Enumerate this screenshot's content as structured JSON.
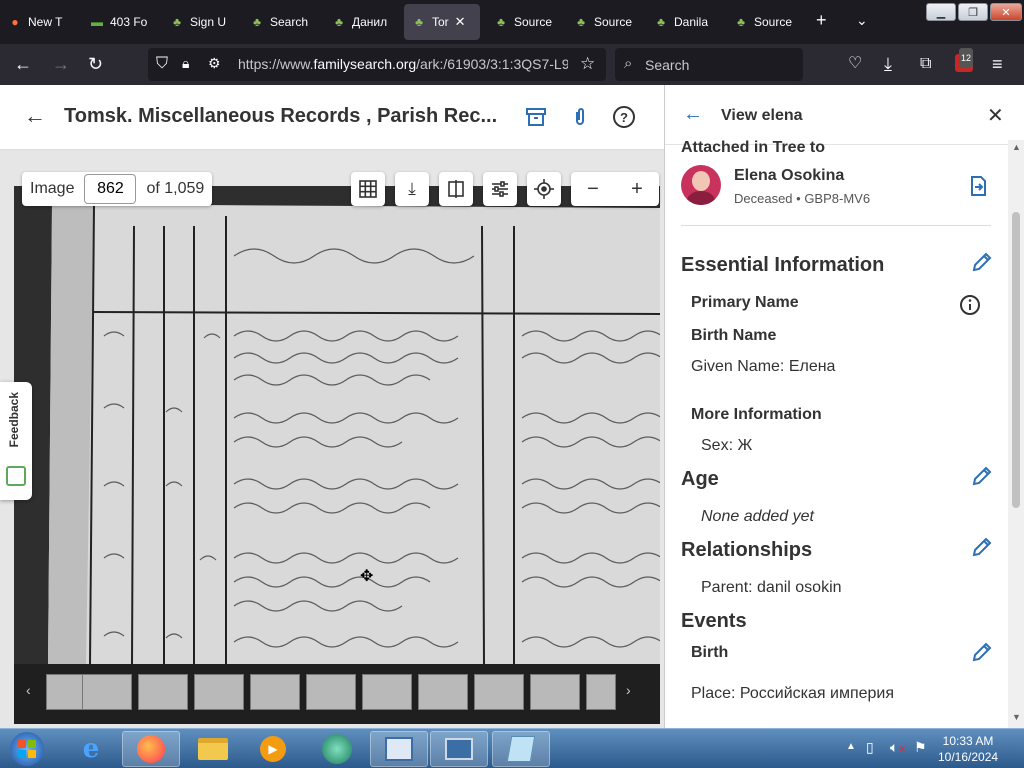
{
  "browser": {
    "tabs": [
      {
        "label": "New T",
        "icon": "firefox-icon"
      },
      {
        "label": "403 Fo",
        "icon": "flag-icon"
      },
      {
        "label": "Sign U",
        "icon": "tree-icon"
      },
      {
        "label": "Search",
        "icon": "tree-icon"
      },
      {
        "label": "Данил",
        "icon": "tree-icon"
      },
      {
        "label": "Tor",
        "icon": "tree-icon",
        "active": true
      },
      {
        "label": "Source",
        "icon": "tree-icon"
      },
      {
        "label": "Source",
        "icon": "tree-icon"
      },
      {
        "label": "Danila",
        "icon": "tree-icon"
      },
      {
        "label": "Source",
        "icon": "tree-icon"
      }
    ],
    "url_prefix": "https://www.",
    "url_domain": "familysearch.org",
    "url_path": "/ark:/61903/3:1:3QS7-L9",
    "search_placeholder": "Search",
    "extension_badge": "12"
  },
  "viewer": {
    "title": "Tomsk. Miscellaneous Records , Parish Rec...",
    "image_label": "Image",
    "image_number": "862",
    "image_total": "of 1,059",
    "feedback_label": "Feedback"
  },
  "panel": {
    "title": "View elena",
    "attached_label": "Attached in Tree to",
    "person_name": "Elena Osokina",
    "person_meta": "Deceased • GBP8-MV6",
    "essential_heading": "Essential Information",
    "primary_name_label": "Primary Name",
    "birth_name_label": "Birth Name",
    "given_name": "Given Name: Елена",
    "more_info_label": "More Information",
    "sex": "Sex: Ж",
    "age_heading": "Age",
    "age_value": "None added yet",
    "relationships_heading": "Relationships",
    "parent": "Parent: danil osokin",
    "events_heading": "Events",
    "birth_label": "Birth",
    "birth_place": "Place: Российская империя"
  },
  "taskbar": {
    "time": "10:33 AM",
    "date": "10/16/2024"
  },
  "colors": {
    "accent": "#2d6fb5",
    "browser_dark": "#1c1b22",
    "avatar": "#c8325c"
  }
}
